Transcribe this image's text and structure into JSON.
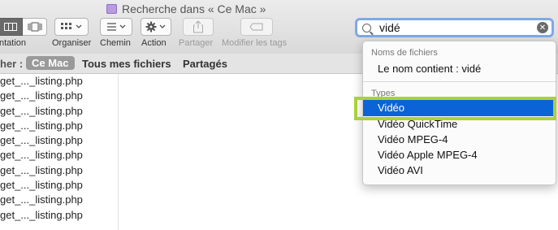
{
  "window": {
    "title": "Recherche dans « Ce Mac »"
  },
  "toolbar": {
    "presentation_label": "ntation",
    "organiser_label": "Organiser",
    "chemin_label": "Chemin",
    "action_label": "Action",
    "partager_label": "Partager",
    "tags_label": "Modifier les tags"
  },
  "search": {
    "value": "vidé"
  },
  "scope": {
    "label": "her :",
    "selected": "Ce Mac",
    "options": [
      "Tous mes fichiers",
      "Partagés"
    ]
  },
  "files": [
    "get_..._listing.php",
    "get_..._listing.php",
    "get_..._listing.php",
    "get_..._listing.php",
    "get_..._listing.php",
    "get_..._listing.php",
    "get_..._listing.php",
    "get_..._listing.php",
    "get_..._listing.php",
    "get_..._listing.php"
  ],
  "menu": {
    "section1_header": "Noms de fichiers",
    "name_contains": "Le nom contient : vidé",
    "section2_header": "Types",
    "types": [
      "Vidéo",
      "Vidéo QuickTime",
      "Vidéo MPEG-4",
      "Vidéo Apple MPEG-4",
      "Vidéo AVI"
    ],
    "selected_type": "Vidéo"
  },
  "colors": {
    "selection": "#0a64d8",
    "highlight_box": "#a9d234",
    "search_focus": "#7fa9e6"
  }
}
